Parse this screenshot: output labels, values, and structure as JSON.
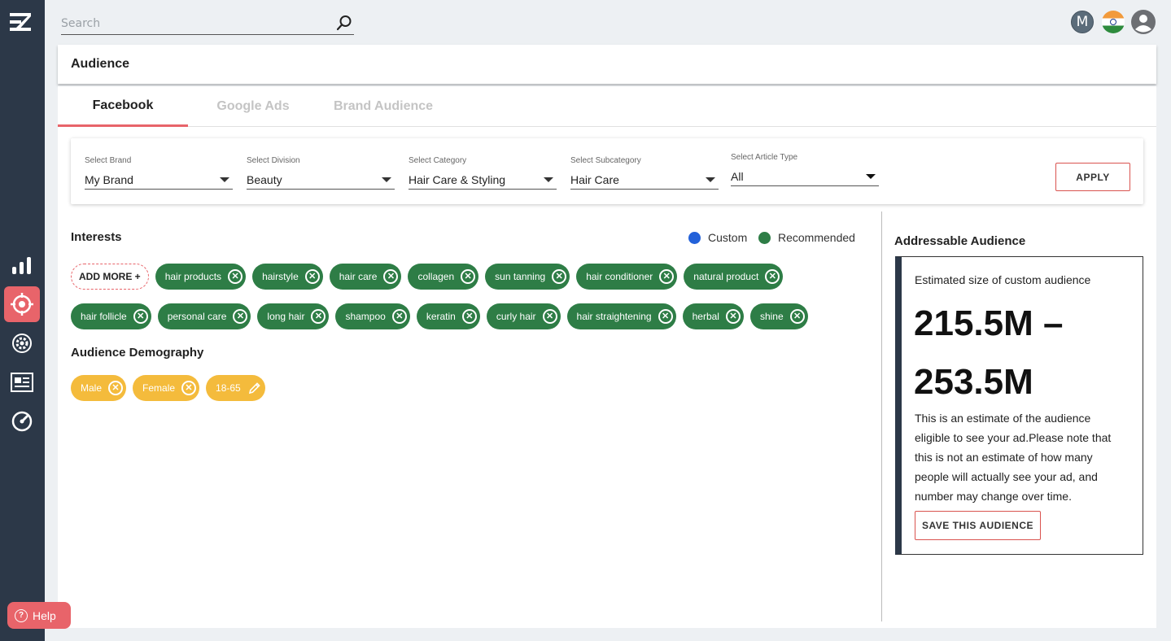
{
  "search": {
    "placeholder": "Search"
  },
  "user": {
    "initial": "M"
  },
  "page": {
    "title": "Audience"
  },
  "tabs": [
    {
      "label": "Facebook",
      "active": true
    },
    {
      "label": "Google Ads",
      "active": false
    },
    {
      "label": "Brand Audience",
      "active": false
    }
  ],
  "filters": [
    {
      "label": "Select Brand",
      "value": "My Brand"
    },
    {
      "label": "Select Division",
      "value": "Beauty"
    },
    {
      "label": "Select Category",
      "value": "Hair Care & Styling"
    },
    {
      "label": "Select Subcategory",
      "value": "Hair Care"
    },
    {
      "label": "Select Article Type",
      "value": "All"
    }
  ],
  "apply_label": "APPLY",
  "interests": {
    "title": "Interests",
    "legend": [
      {
        "label": "Custom",
        "color": "#2361d9"
      },
      {
        "label": "Recommended",
        "color": "#2e7d46"
      }
    ],
    "add_more_label": "ADD MORE +",
    "chips_row1": [
      "hair products",
      "hairstyle",
      "hair care",
      "collagen",
      "sun tanning",
      "hair conditioner",
      "natural product"
    ],
    "chips_row2": [
      "hair follicle",
      "personal care",
      "long hair",
      "shampoo",
      "keratin",
      "curly hair",
      "hair straightening",
      "herbal",
      "shine"
    ]
  },
  "demography": {
    "title": "Audience Demography",
    "chips": [
      "Male",
      "Female"
    ],
    "age_range": "18-65"
  },
  "addressable": {
    "title": "Addressable Audience",
    "subtitle": "Estimated size of custom audience",
    "estimate": "215.5M – 253.5M",
    "description": "This is an estimate of the audience eligible to see your ad.Please note that this is not an estimate of how many people will actually see your ad, and number may change over time.",
    "save_label": "SAVE THIS AUDIENCE"
  },
  "help_label": "Help",
  "colors": {
    "sidebar": "#2c3848",
    "accent": "#e8646a",
    "chip_green": "#2e7d46",
    "chip_yellow": "#f4bb3c"
  }
}
